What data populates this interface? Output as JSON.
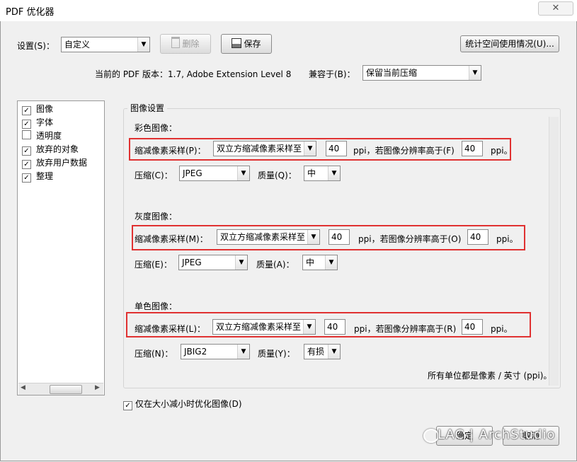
{
  "window": {
    "title": "PDF 优化器",
    "close": "✕"
  },
  "settings": {
    "label": "设置(S)：",
    "value": "自定义",
    "delete_label": "删除",
    "save_label": "保存",
    "stats_label": "统计空间使用情况(U)..."
  },
  "version": {
    "text": "当前的 PDF 版本：1.7, Adobe Extension Level 8",
    "compat_label": "兼容于(B)：",
    "compat_value": "保留当前压缩"
  },
  "sidebar": {
    "items": [
      {
        "label": "图像",
        "checked": true
      },
      {
        "label": "字体",
        "checked": true
      },
      {
        "label": "透明度",
        "checked": false
      },
      {
        "label": "放弃的对象",
        "checked": true
      },
      {
        "label": "放弃用户数据",
        "checked": true
      },
      {
        "label": "整理",
        "checked": true
      }
    ]
  },
  "image_settings": {
    "title": "图像设置",
    "color": {
      "heading": "彩色图像：",
      "downsample_label": "缩减像素采样(P)：",
      "method": "双立方缩减像素采样至",
      "ppi_value": "40",
      "ppi_text": "ppi，若图像分辨率高于(F)",
      "above_value": "40",
      "ppi_end": "ppi。",
      "compression_label": "压缩(C)：",
      "compression": "JPEG",
      "quality_label": "质量(Q)：",
      "quality": "中"
    },
    "gray": {
      "heading": "灰度图像：",
      "downsample_label": "缩减像素采样(M)：",
      "method": "双立方缩减像素采样至",
      "ppi_value": "40",
      "ppi_text": "ppi，若图像分辨率高于(O)",
      "above_value": "40",
      "ppi_end": "ppi。",
      "compression_label": "压缩(E)：",
      "compression": "JPEG",
      "quality_label": "质量(A)：",
      "quality": "中"
    },
    "mono": {
      "heading": "单色图像：",
      "downsample_label": "缩减像素采样(L)：",
      "method": "双立方缩减像素采样至",
      "ppi_value": "40",
      "ppi_text": "ppi，若图像分辨率高于(R)",
      "above_value": "40",
      "ppi_end": "ppi。",
      "compression_label": "压缩(N)：",
      "compression": "JBIG2",
      "quality_label": "质量(Y)：",
      "quality": "有损"
    },
    "units_note": "所有单位都是像素 / 英寸 (ppi)。"
  },
  "optimize_only": {
    "label": "仅在大小减小时优化图像(D)",
    "checked": true
  },
  "footer": {
    "ok_label": "确定",
    "cancel_label": "取消",
    "watermark": "LAC | ArchStudio"
  }
}
